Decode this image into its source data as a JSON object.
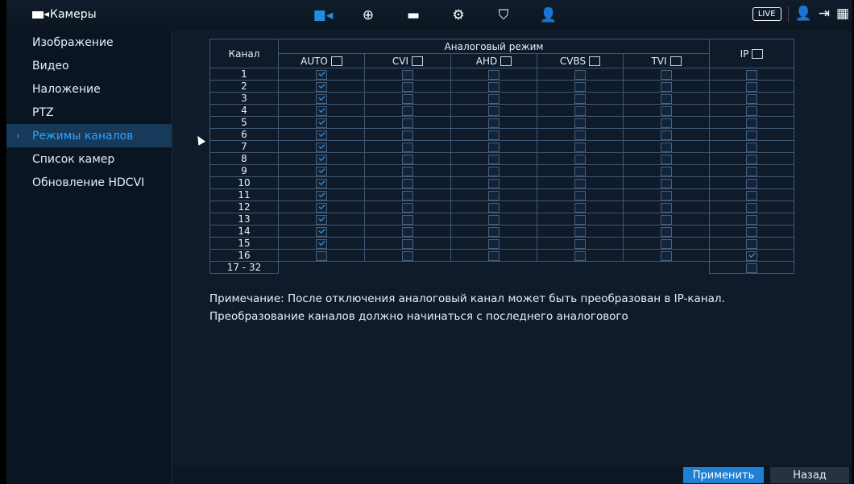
{
  "header": {
    "title": "Камеры",
    "live_label": "LIVE",
    "nav_icons": [
      "camera-icon",
      "network-icon",
      "storage-icon",
      "settings-icon",
      "security-icon",
      "account-icon"
    ]
  },
  "sidebar": {
    "items": [
      {
        "label": "Изображение"
      },
      {
        "label": "Видео"
      },
      {
        "label": "Наложение"
      },
      {
        "label": "PTZ"
      },
      {
        "label": "Режимы каналов"
      },
      {
        "label": "Список камер"
      },
      {
        "label": "Обновление HDCVI"
      }
    ],
    "active_index": 4
  },
  "table": {
    "channel_header": "Канал",
    "analog_header": "Аналоговый режим",
    "ip_header": "IP",
    "modes": [
      "AUTO",
      "CVI",
      "AHD",
      "CVBS",
      "TVI"
    ],
    "rows": [
      {
        "ch": "1",
        "auto": true,
        "ip": false
      },
      {
        "ch": "2",
        "auto": true,
        "ip": false
      },
      {
        "ch": "3",
        "auto": true,
        "ip": false
      },
      {
        "ch": "4",
        "auto": true,
        "ip": false
      },
      {
        "ch": "5",
        "auto": true,
        "ip": false
      },
      {
        "ch": "6",
        "auto": true,
        "ip": false
      },
      {
        "ch": "7",
        "auto": true,
        "ip": false
      },
      {
        "ch": "8",
        "auto": true,
        "ip": false
      },
      {
        "ch": "9",
        "auto": true,
        "ip": false
      },
      {
        "ch": "10",
        "auto": true,
        "ip": false
      },
      {
        "ch": "11",
        "auto": true,
        "ip": false
      },
      {
        "ch": "12",
        "auto": true,
        "ip": false
      },
      {
        "ch": "13",
        "auto": true,
        "ip": false
      },
      {
        "ch": "14",
        "auto": true,
        "ip": false
      },
      {
        "ch": "15",
        "auto": true,
        "ip": false
      },
      {
        "ch": "16",
        "auto": false,
        "ip": true
      }
    ],
    "last_row_label": "17 - 32"
  },
  "note": "Примечание: После отключения аналоговый канал может быть преобразован в IP-канал. Преобразование каналов должно начинаться с последнего аналогового",
  "buttons": {
    "apply": "Применить",
    "back": "Назад"
  },
  "colors": {
    "accent": "#1f7fd1",
    "active_text": "#2ea3ff",
    "background": "#0f1b2a"
  }
}
